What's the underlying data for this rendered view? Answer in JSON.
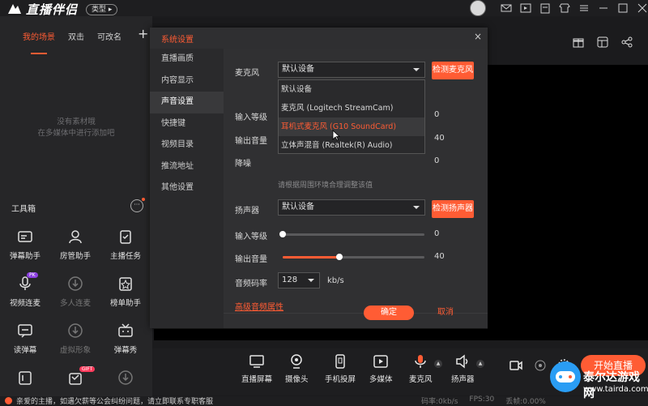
{
  "app": {
    "name": "直播伴侣",
    "type_label": "类型"
  },
  "scenes": {
    "tabs": [
      "我的场景",
      "双击",
      "可改名"
    ],
    "add": "+"
  },
  "empty_hint": {
    "line1": "没有素材哦",
    "line2": "在多媒体中进行添加吧"
  },
  "toolbox": {
    "title": "工具箱",
    "more": "···",
    "tools": [
      {
        "label": "弹幕助手",
        "icon": "danmaku-icon",
        "dim": false
      },
      {
        "label": "房管助手",
        "icon": "room-admin-icon",
        "dim": false
      },
      {
        "label": "主播任务",
        "icon": "task-icon",
        "dim": false
      },
      {
        "label": "视频连麦",
        "icon": "video-link-icon",
        "dim": false,
        "badge": "PK"
      },
      {
        "label": "多人连麦",
        "icon": "multi-link-icon",
        "dim": true
      },
      {
        "label": "榜单助手",
        "icon": "rank-icon",
        "dim": false
      },
      {
        "label": "读弹幕",
        "icon": "read-danmaku-icon",
        "dim": false
      },
      {
        "label": "虚拟形象",
        "icon": "avatar-icon",
        "dim": true
      },
      {
        "label": "弹幕秀",
        "icon": "danmaku-show-icon",
        "dim": false
      }
    ],
    "partial_row_badge": "GIFT"
  },
  "status": {
    "message": "亲爱的主播，如遇欠薪等公会纠纷问题，请立即联系专职客服",
    "bitrate": "码率:0kb/s",
    "fps": "FPS:30",
    "drop": "丢帧:0.00%"
  },
  "bottombar": {
    "items": [
      {
        "label": "直播屏幕",
        "icon": "screen-icon"
      },
      {
        "label": "摄像头",
        "icon": "camera-icon"
      },
      {
        "label": "手机投屏",
        "icon": "phone-cast-icon"
      },
      {
        "label": "多媒体",
        "icon": "media-icon"
      },
      {
        "label": "麦克风",
        "icon": "mic-icon"
      },
      {
        "label": "扬声器",
        "icon": "speaker-icon"
      }
    ],
    "start_live": "开始直播"
  },
  "dialog": {
    "title": "系统设置",
    "close": "×",
    "nav": [
      "直播画质",
      "内容显示",
      "声音设置",
      "快捷键",
      "视频目录",
      "推流地址",
      "其他设置"
    ],
    "active_nav": 2,
    "mic": {
      "label": "麦克风",
      "selected": "默认设备",
      "detect": "检测麦克风"
    },
    "mic_dropdown": [
      "默认设备",
      "麦克风 (Logitech StreamCam)",
      "耳机式麦克风 (G10 SoundCard)",
      "立体声混音 (Realtek(R) Audio)"
    ],
    "hovered_option": 2,
    "mic_rows": [
      {
        "label": "输入等级",
        "value": "0"
      },
      {
        "label": "输出音量",
        "value": "40"
      },
      {
        "label": "降噪",
        "value": "0"
      }
    ],
    "noise_hint": "请根据周围环境合理调整该值",
    "speaker": {
      "label": "扬声器",
      "selected": "默认设备",
      "detect": "检测扬声器"
    },
    "speaker_input": {
      "label": "输入等级",
      "value": "0",
      "level": 0
    },
    "speaker_output": {
      "label": "输出音量",
      "value": "40",
      "level": 0.4
    },
    "bitrate": {
      "label": "音频码率",
      "selected": "128",
      "unit": "kb/s"
    },
    "advanced": "高级音频属性",
    "ok": "确定",
    "cancel": "取消"
  },
  "watermark": {
    "name": "泰尔达游戏网",
    "url": "www.tairda.com"
  },
  "colors": {
    "accent": "#ff5c34",
    "bg": "#1b1b1d"
  }
}
